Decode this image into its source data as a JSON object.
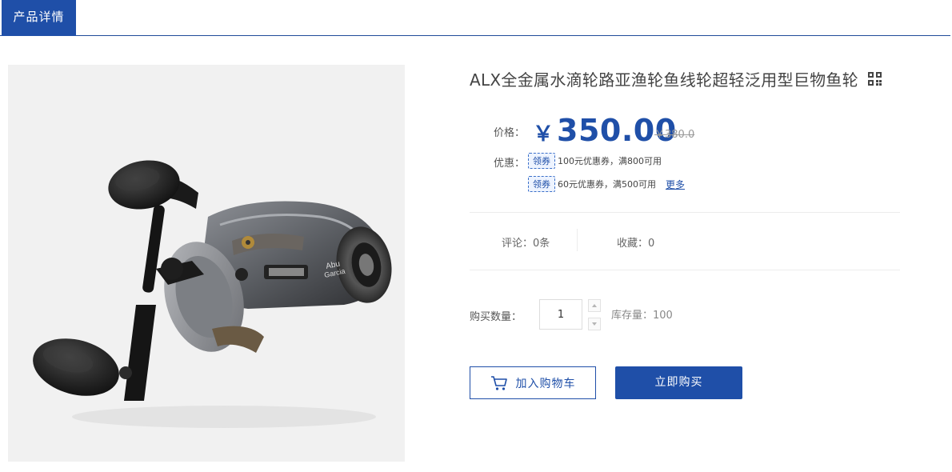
{
  "tabs": {
    "active_label": "产品详情"
  },
  "product": {
    "image_alt": "钓鱼水滴轮产品图",
    "title": "ALX全金属水滴轮路亚渔轮鱼线轮超轻泛用型巨物鱼轮",
    "qr_icon": "qr-code-icon"
  },
  "price": {
    "label": "价格：",
    "currency_symbol": "￥",
    "current": "350.00",
    "original": "￥380.0",
    "accent_color": "#1f4fa8"
  },
  "promotion": {
    "label": "优惠：",
    "coupons": [
      {
        "tag": "领券",
        "text": "100元优惠券，满800可用"
      },
      {
        "tag": "领券",
        "text": "60元优惠券，满500可用"
      }
    ],
    "more_label": "更多"
  },
  "stats": {
    "comments": "评论：0条",
    "favorites": "收藏：0"
  },
  "purchase": {
    "qty_label": "购买数量：",
    "qty_value": "1",
    "stock": "库存量：100",
    "add_to_cart_label": "加入购物车",
    "buy_now_label": "立即购买"
  }
}
